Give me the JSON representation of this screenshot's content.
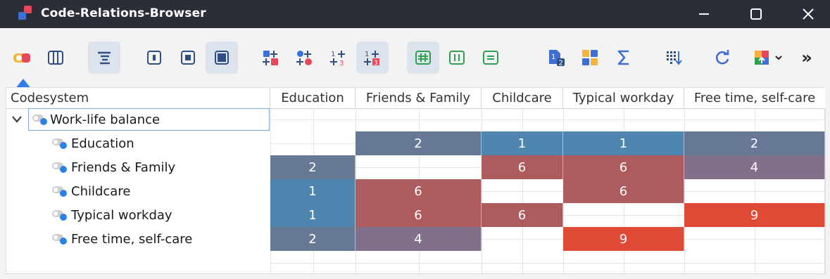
{
  "window": {
    "title": "Code-Relations-Browser"
  },
  "toolbar": {
    "overflow_label": "»"
  },
  "table": {
    "first_header": "Codesystem",
    "headers": [
      "Education",
      "Friends & Family",
      "Childcare",
      "Typical workday",
      "Free time, self-care"
    ],
    "root": "Work-life balance",
    "rows": [
      {
        "label": "Education",
        "cells": [
          "",
          "2",
          "1",
          "1",
          "2"
        ]
      },
      {
        "label": "Friends & Family",
        "cells": [
          "2",
          "",
          "6",
          "6",
          "4"
        ]
      },
      {
        "label": "Childcare",
        "cells": [
          "1",
          "6",
          "",
          "6",
          ""
        ]
      },
      {
        "label": "Typical workday",
        "cells": [
          "1",
          "6",
          "6",
          "",
          "9"
        ]
      },
      {
        "label": "Free time, self-care",
        "cells": [
          "2",
          "4",
          "",
          "9",
          ""
        ]
      }
    ]
  },
  "colors": {
    "titlebar": "#2b2e37",
    "value_1": "#4f86b0",
    "value_2": "#677895",
    "value_4": "#82708a",
    "value_6": "#ad5b5c",
    "value_9": "#df4936",
    "accent": "#2f7fe8"
  }
}
